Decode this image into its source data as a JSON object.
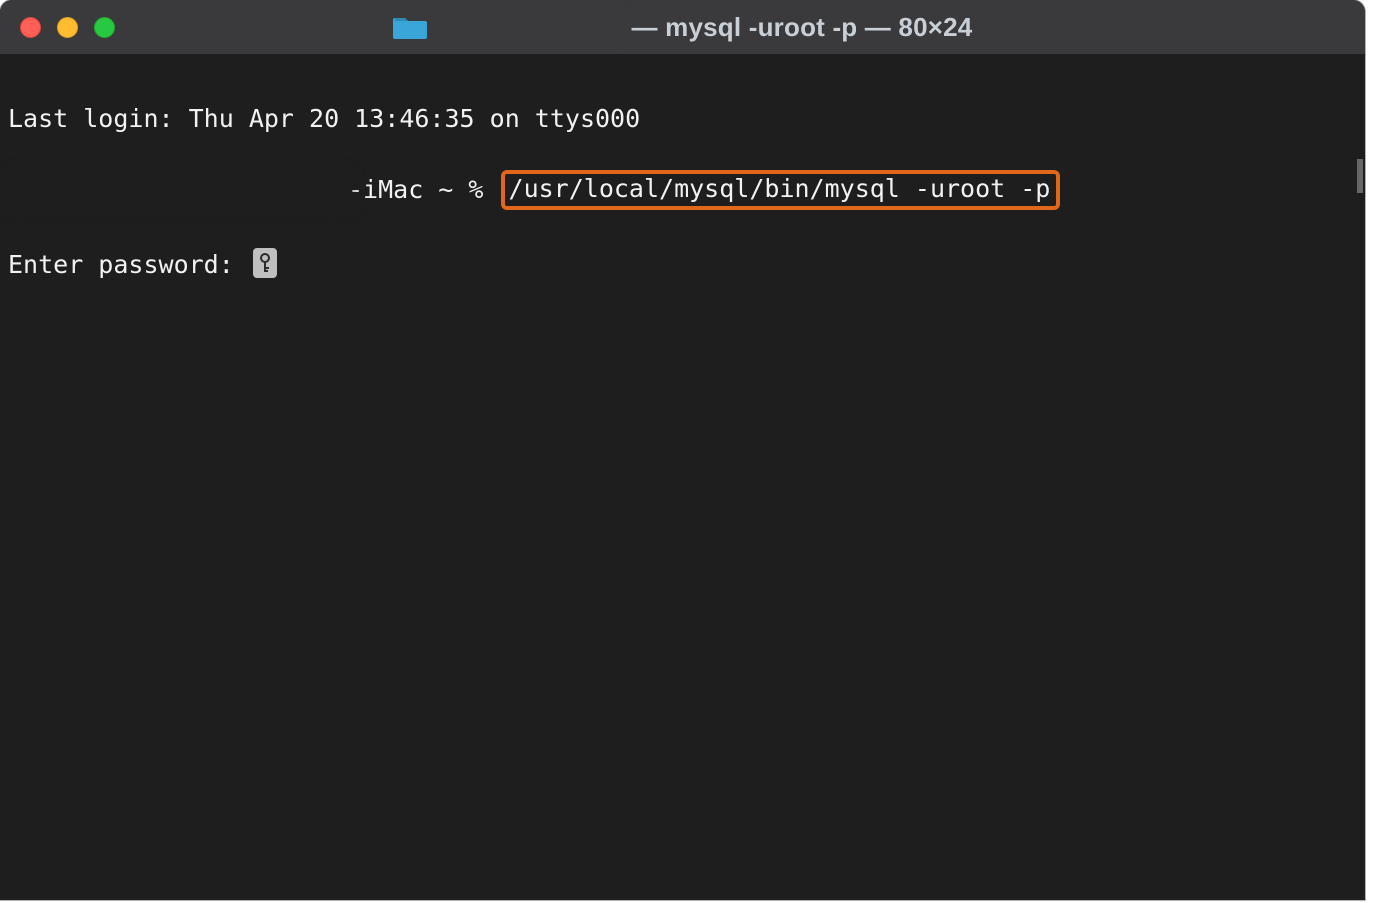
{
  "titlebar": {
    "title_suffix": "— mysql -uroot -p — 80×24"
  },
  "terminal": {
    "last_login_line": "Last login: Thu Apr 20 13:46:35 on ttys000",
    "prompt_suffix": "-iMac ~ % ",
    "highlighted_command": "/usr/local/mysql/bin/mysql -uroot -p",
    "password_prompt": "Enter password: "
  },
  "icons": {
    "folder": "folder-icon",
    "key": "key-icon"
  },
  "colors": {
    "highlight_border": "#e2661b",
    "terminal_bg": "#1e1e1e",
    "titlebar_bg": "#3a3a3c",
    "text": "#f2f2f2"
  }
}
